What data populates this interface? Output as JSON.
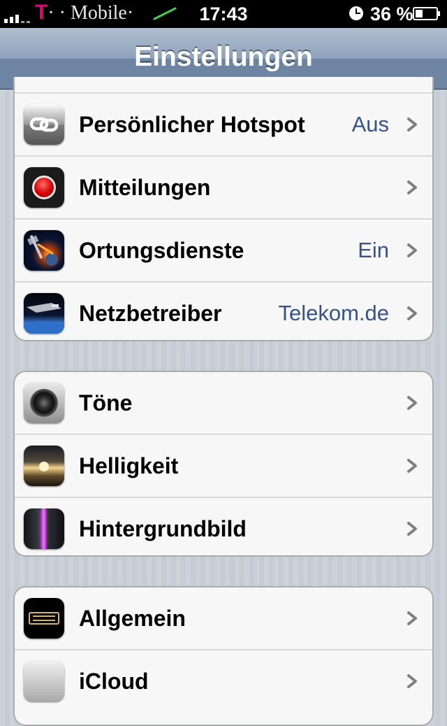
{
  "status_bar": {
    "carrier": "T · · Mobile·",
    "carrier_t": "T",
    "carrier_rest": "· · Mobile·",
    "time": "17:43",
    "battery_percent": "36 %",
    "battery_level": 0.36,
    "signal_bars": 4,
    "icons": [
      "signal-icon",
      "wifi-icon",
      "clock-icon",
      "battery-icon"
    ]
  },
  "nav": {
    "title": "Einstellungen"
  },
  "groups": [
    {
      "cells": [
        {
          "label": "Persönlicher Hotspot",
          "value": "Aus",
          "icon": "hotspot-icon"
        },
        {
          "label": "Mitteilungen",
          "value": "",
          "icon": "notifications-icon"
        },
        {
          "label": "Ortungsdienste",
          "value": "Ein",
          "icon": "location-services-icon"
        },
        {
          "label": "Netzbetreiber",
          "value": "Telekom.de",
          "icon": "carrier-icon"
        }
      ]
    },
    {
      "cells": [
        {
          "label": "Töne",
          "value": "",
          "icon": "sounds-icon"
        },
        {
          "label": "Helligkeit",
          "value": "",
          "icon": "brightness-icon"
        },
        {
          "label": "Hintergrundbild",
          "value": "",
          "icon": "wallpaper-icon"
        }
      ]
    },
    {
      "cells": [
        {
          "label": "Allgemein",
          "value": "",
          "icon": "general-icon"
        },
        {
          "label": "iCloud",
          "value": "",
          "icon": "icloud-icon"
        }
      ]
    }
  ],
  "colors": {
    "value_text": "#385487",
    "carrier_brand": "#e20074",
    "nav_bar": "#6d84a2"
  }
}
